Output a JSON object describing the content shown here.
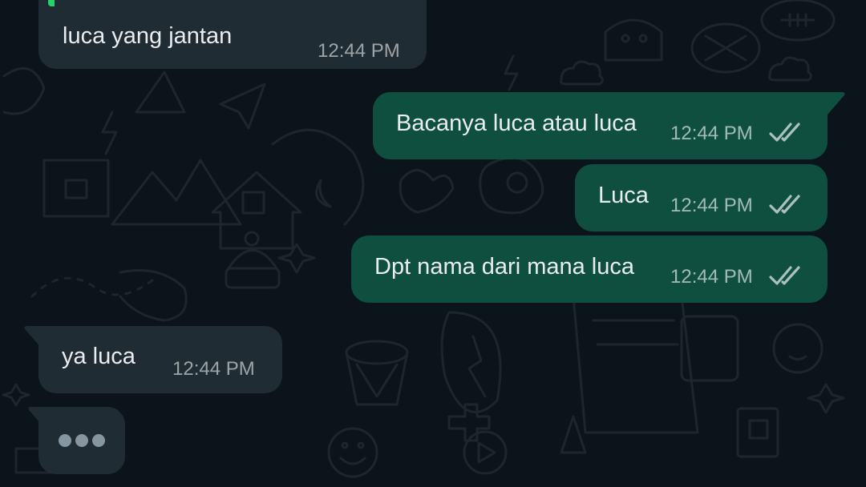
{
  "chat": {
    "colors": {
      "background": "#0b141a",
      "incoming_bubble": "#202c33",
      "outgoing_bubble": "#0f4f3f",
      "text": "#e9edef",
      "meta": "#8696a0",
      "reply_accent": "#25d366"
    },
    "messages": [
      {
        "direction": "incoming",
        "text": "luca yang jantan",
        "time": "12:44 PM"
      },
      {
        "direction": "outgoing",
        "text": "Bacanya luca atau luca",
        "time": "12:44 PM",
        "status": "read-double-check-icon"
      },
      {
        "direction": "outgoing",
        "text": "Luca",
        "time": "12:44 PM",
        "status": "read-double-check-icon"
      },
      {
        "direction": "outgoing",
        "text": "Dpt nama dari mana luca",
        "time": "12:44 PM",
        "status": "read-double-check-icon"
      },
      {
        "direction": "incoming",
        "text": "ya luca",
        "time": "12:44 PM"
      }
    ],
    "typing_indicator": {
      "icon": "typing-dots-icon"
    }
  }
}
